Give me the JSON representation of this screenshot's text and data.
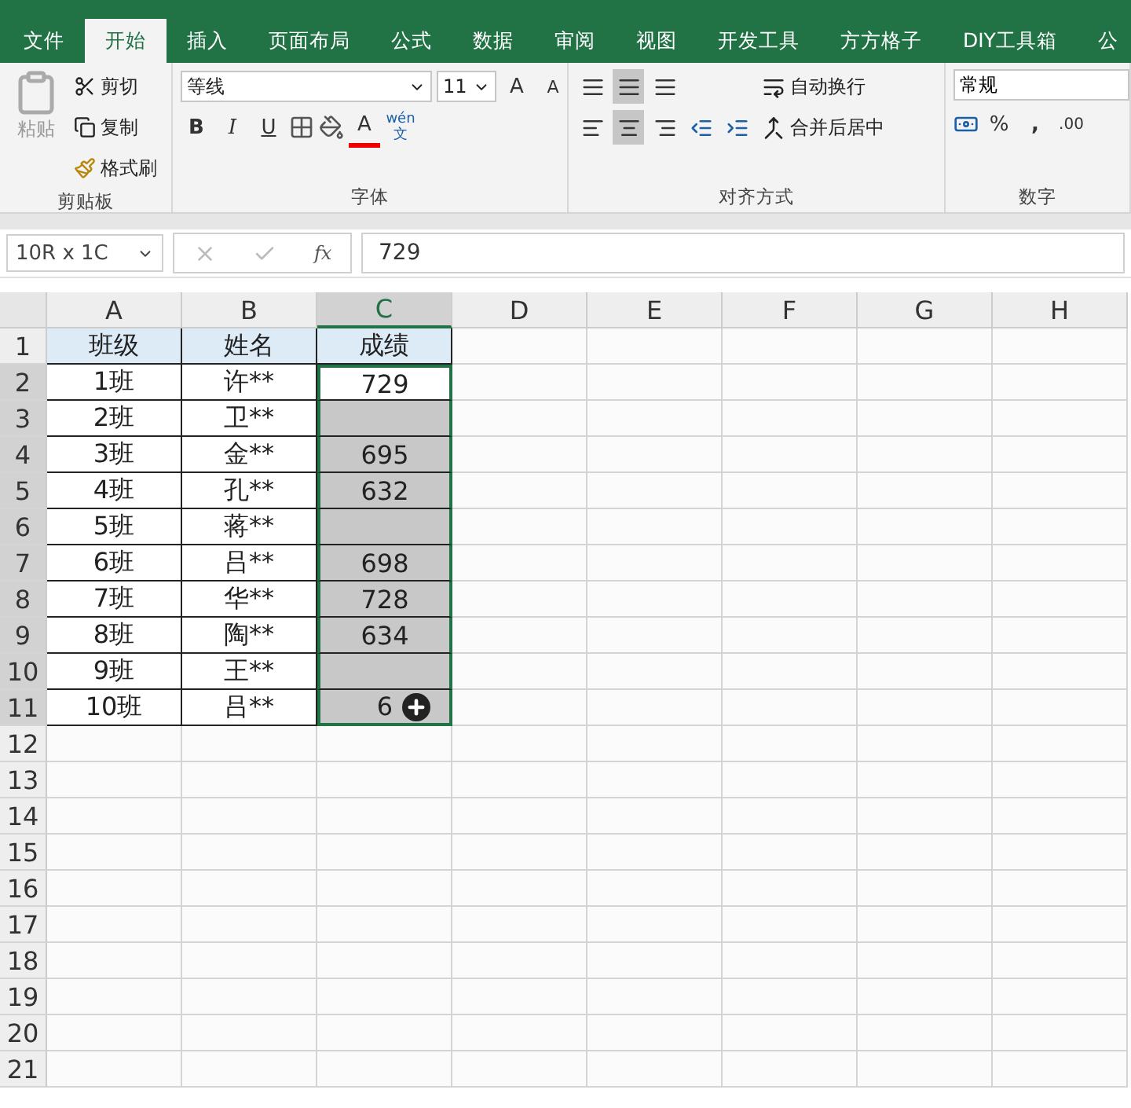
{
  "menu_tabs": [
    {
      "label": "文件",
      "selected": false
    },
    {
      "label": "开始",
      "selected": true
    },
    {
      "label": "插入",
      "selected": false
    },
    {
      "label": "页面布局",
      "selected": false
    },
    {
      "label": "公式",
      "selected": false
    },
    {
      "label": "数据",
      "selected": false
    },
    {
      "label": "审阅",
      "selected": false
    },
    {
      "label": "视图",
      "selected": false
    },
    {
      "label": "开发工具",
      "selected": false
    },
    {
      "label": "方方格子",
      "selected": false
    },
    {
      "label": "DIY工具箱",
      "selected": false
    },
    {
      "label": "公",
      "selected": false
    }
  ],
  "clipboard": {
    "paste": "粘贴",
    "cut": "剪切",
    "copy": "复制",
    "format_painter": "格式刷",
    "group": "剪贴板"
  },
  "font": {
    "name": "等线",
    "size": "11",
    "bold": "B",
    "italic": "I",
    "underline": "U",
    "font_color": "A",
    "phonetic_top": "wén",
    "phonetic_bottom": "文",
    "grow": "A",
    "shrink": "A",
    "group": "字体"
  },
  "alignment": {
    "wrap": "自动换行",
    "merge": "合并后居中",
    "group": "对齐方式"
  },
  "number": {
    "format": "常规",
    "percent": "%",
    "comma": ",",
    "decimal": ".00",
    "group": "数字"
  },
  "formula_bar": {
    "name_box": "10R x 1C",
    "fx": "fx",
    "value": "729"
  },
  "columns": [
    {
      "label": "A",
      "selected": false
    },
    {
      "label": "B",
      "selected": false
    },
    {
      "label": "C",
      "selected": true
    },
    {
      "label": "D",
      "selected": false
    },
    {
      "label": "E",
      "selected": false
    },
    {
      "label": "F",
      "selected": false
    },
    {
      "label": "G",
      "selected": false
    },
    {
      "label": "H",
      "selected": false
    }
  ],
  "rows": [
    {
      "number": "1",
      "kind": "header",
      "cells": [
        "班级",
        "姓名",
        "成绩"
      ]
    },
    {
      "number": "2",
      "kind": "data",
      "selected": true,
      "active": true,
      "cells": [
        "1班",
        "许**",
        "729"
      ]
    },
    {
      "number": "3",
      "kind": "data",
      "selected": true,
      "active": false,
      "cells": [
        "2班",
        "卫**",
        ""
      ]
    },
    {
      "number": "4",
      "kind": "data",
      "selected": true,
      "active": false,
      "cells": [
        "3班",
        "金**",
        "695"
      ]
    },
    {
      "number": "5",
      "kind": "data",
      "selected": true,
      "active": false,
      "cells": [
        "4班",
        "孔**",
        "632"
      ]
    },
    {
      "number": "6",
      "kind": "data",
      "selected": true,
      "active": false,
      "cells": [
        "5班",
        "蒋**",
        ""
      ]
    },
    {
      "number": "7",
      "kind": "data",
      "selected": true,
      "active": false,
      "cells": [
        "6班",
        "吕**",
        "698"
      ]
    },
    {
      "number": "8",
      "kind": "data",
      "selected": true,
      "active": false,
      "cells": [
        "7班",
        "华**",
        "728"
      ]
    },
    {
      "number": "9",
      "kind": "data",
      "selected": true,
      "active": false,
      "cells": [
        "8班",
        "陶**",
        "634"
      ]
    },
    {
      "number": "10",
      "kind": "data",
      "selected": true,
      "active": false,
      "cells": [
        "9班",
        "王**",
        ""
      ]
    },
    {
      "number": "11",
      "kind": "data",
      "selected": true,
      "active": false,
      "cells": [
        "10班",
        "吕**",
        "6"
      ]
    },
    {
      "number": "12",
      "kind": "empty"
    },
    {
      "number": "13",
      "kind": "empty"
    },
    {
      "number": "14",
      "kind": "empty"
    },
    {
      "number": "15",
      "kind": "empty"
    },
    {
      "number": "16",
      "kind": "empty"
    },
    {
      "number": "17",
      "kind": "empty"
    },
    {
      "number": "18",
      "kind": "empty"
    },
    {
      "number": "19",
      "kind": "empty"
    },
    {
      "number": "20",
      "kind": "empty"
    },
    {
      "number": "21",
      "kind": "empty"
    }
  ]
}
